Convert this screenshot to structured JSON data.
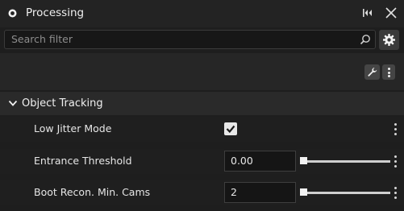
{
  "window": {
    "title": "Processing",
    "icons": {
      "title": "radio-dot-icon",
      "pin": "collapse-left-icon",
      "close": "close-icon"
    }
  },
  "search": {
    "placeholder": "Search filter",
    "icon": "search-icon",
    "settings_icon": "gear-icon"
  },
  "toolbar": {
    "wrench_icon": "wrench-icon",
    "more_icon": "vertical-dots-icon"
  },
  "section": {
    "title": "Object Tracking",
    "expanded": true
  },
  "properties": [
    {
      "label": "Low Jitter Mode",
      "type": "checkbox",
      "checked": true
    },
    {
      "label": "Entrance Threshold",
      "type": "number-slider",
      "value": "0.00",
      "slider_fraction": 0.0
    },
    {
      "label": "Boot Recon. Min. Cams",
      "type": "number-slider",
      "value": "2",
      "slider_fraction": 0.0
    }
  ],
  "colors": {
    "background": "#1e1e1e",
    "text": "#e6e6e6",
    "placeholder": "#8d8d8d"
  }
}
